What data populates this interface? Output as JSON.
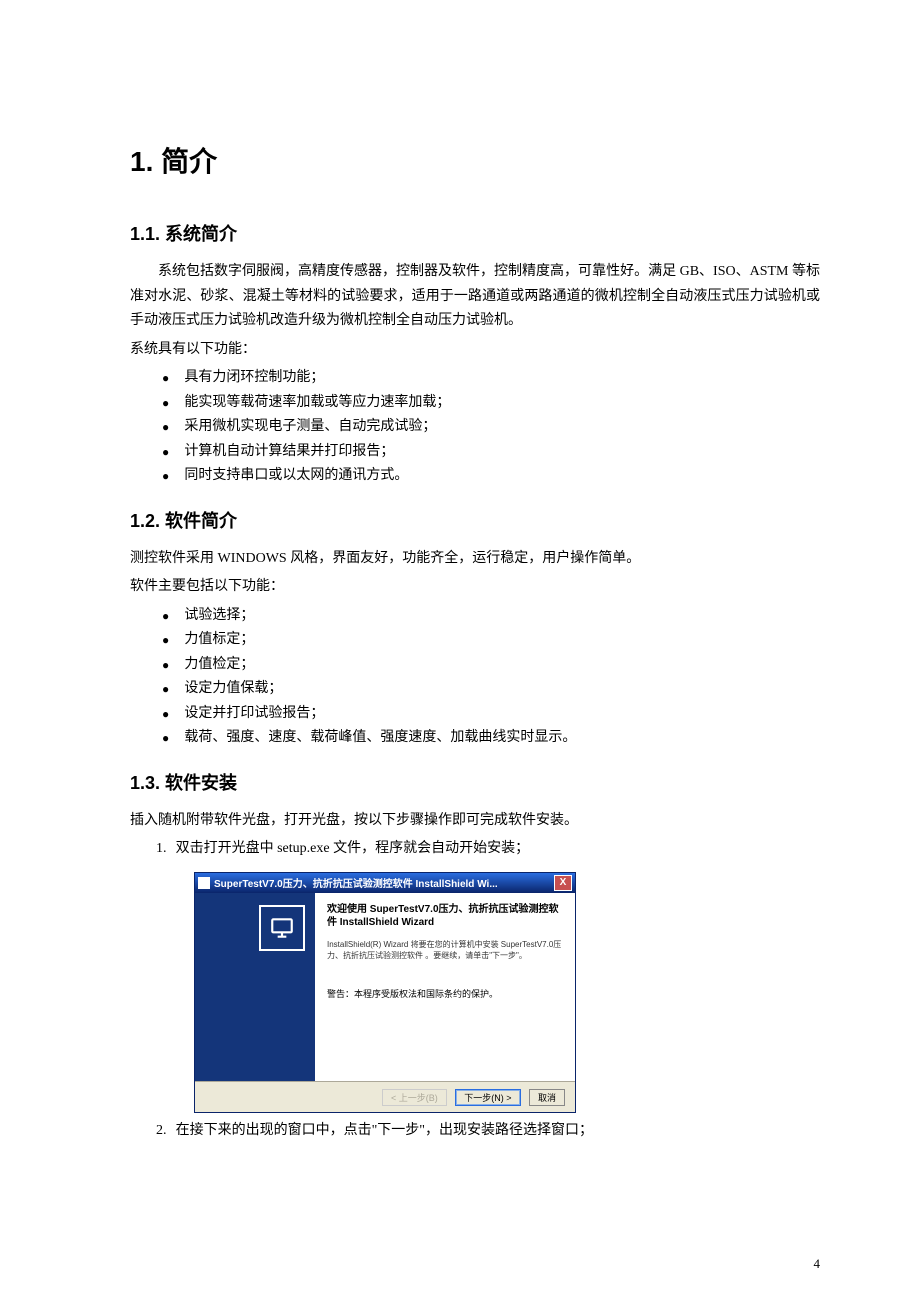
{
  "h1": "1. 简介",
  "s11": {
    "title": "1.1. 系统简介",
    "p1": "系统包括数字伺服阀，高精度传感器，控制器及软件，控制精度高，可靠性好。满足 GB、ISO、ASTM 等标准对水泥、砂浆、混凝土等材料的试验要求，适用于一路通道或两路通道的微机控制全自动液压式压力试验机或手动液压式压力试验机改造升级为微机控制全自动压力试验机。",
    "p2": "系统具有以下功能：",
    "items": [
      "具有力闭环控制功能；",
      "能实现等载荷速率加载或等应力速率加载；",
      "采用微机实现电子测量、自动完成试验；",
      "计算机自动计算结果并打印报告；",
      "同时支持串口或以太网的通讯方式。"
    ]
  },
  "s12": {
    "title": "1.2. 软件简介",
    "p1": "测控软件采用 WINDOWS 风格，界面友好，功能齐全，运行稳定，用户操作简单。",
    "p2": "软件主要包括以下功能：",
    "items": [
      "试验选择；",
      "力值标定；",
      "力值检定；",
      "设定力值保载；",
      "设定并打印试验报告；",
      "载荷、强度、速度、载荷峰值、强度速度、加载曲线实时显示。"
    ]
  },
  "s13": {
    "title": "1.3. 软件安装",
    "p1": "插入随机附带软件光盘，打开光盘，按以下步骤操作即可完成软件安装。",
    "step1": "双击打开光盘中 setup.exe 文件，程序就会自动开始安装；",
    "installer": {
      "title": "SuperTestV7.0压力、抗折抗压试验测控软件 InstallShield Wi...",
      "close": "X",
      "welcome": "欢迎使用 SuperTestV7.0压力、抗折抗压试验测控软件 InstallShield Wizard",
      "desc": "InstallShield(R) Wizard 将要在您的计算机中安装 SuperTestV7.0压力、抗折抗压试验测控软件 。要继续，请单击\"下一步\"。",
      "warn": "警告：本程序受版权法和国际条约的保护。",
      "btn_back": "< 上一步(B)",
      "btn_next": "下一步(N) >",
      "btn_cancel": "取消"
    },
    "step2": "在接下来的出现的窗口中，点击\"下一步\"，出现安装路径选择窗口；"
  },
  "page_num": "4"
}
